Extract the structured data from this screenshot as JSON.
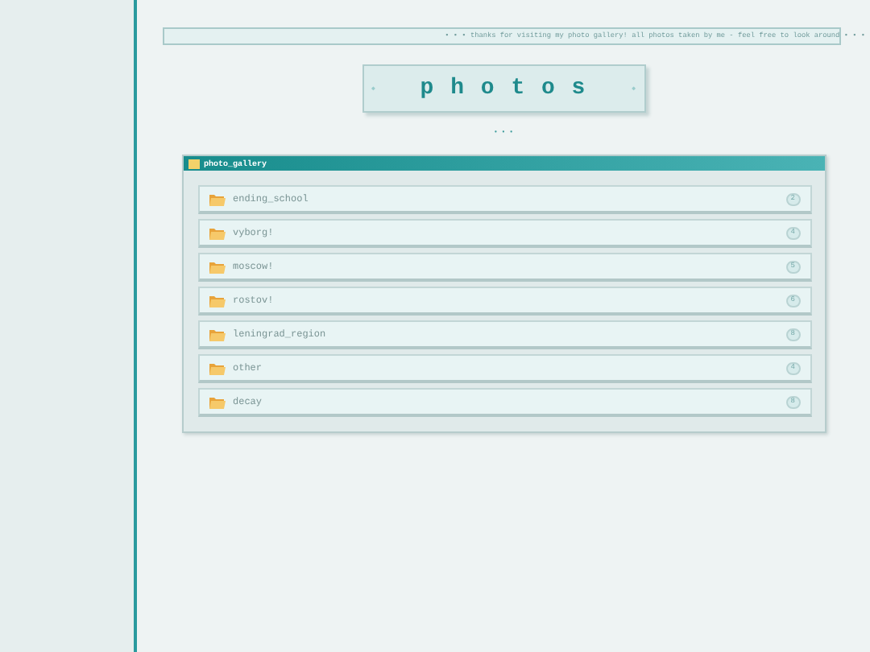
{
  "marquee": "• • • thanks for visiting my photo gallery! all photos taken by me - feel free to look around • • •",
  "title": {
    "letters": "p h o t o s",
    "mark_left": "◆",
    "mark_right": "◆"
  },
  "divider": "• • •",
  "gallery": {
    "title": "photo_gallery",
    "folders": [
      {
        "name": "ending_school",
        "count": "2"
      },
      {
        "name": "vyborg!",
        "count": "4"
      },
      {
        "name": "moscow!",
        "count": "5"
      },
      {
        "name": "rostov!",
        "count": "6"
      },
      {
        "name": "leningrad_region",
        "count": "8"
      },
      {
        "name": "other",
        "count": "4"
      },
      {
        "name": "decay",
        "count": "8"
      }
    ]
  }
}
